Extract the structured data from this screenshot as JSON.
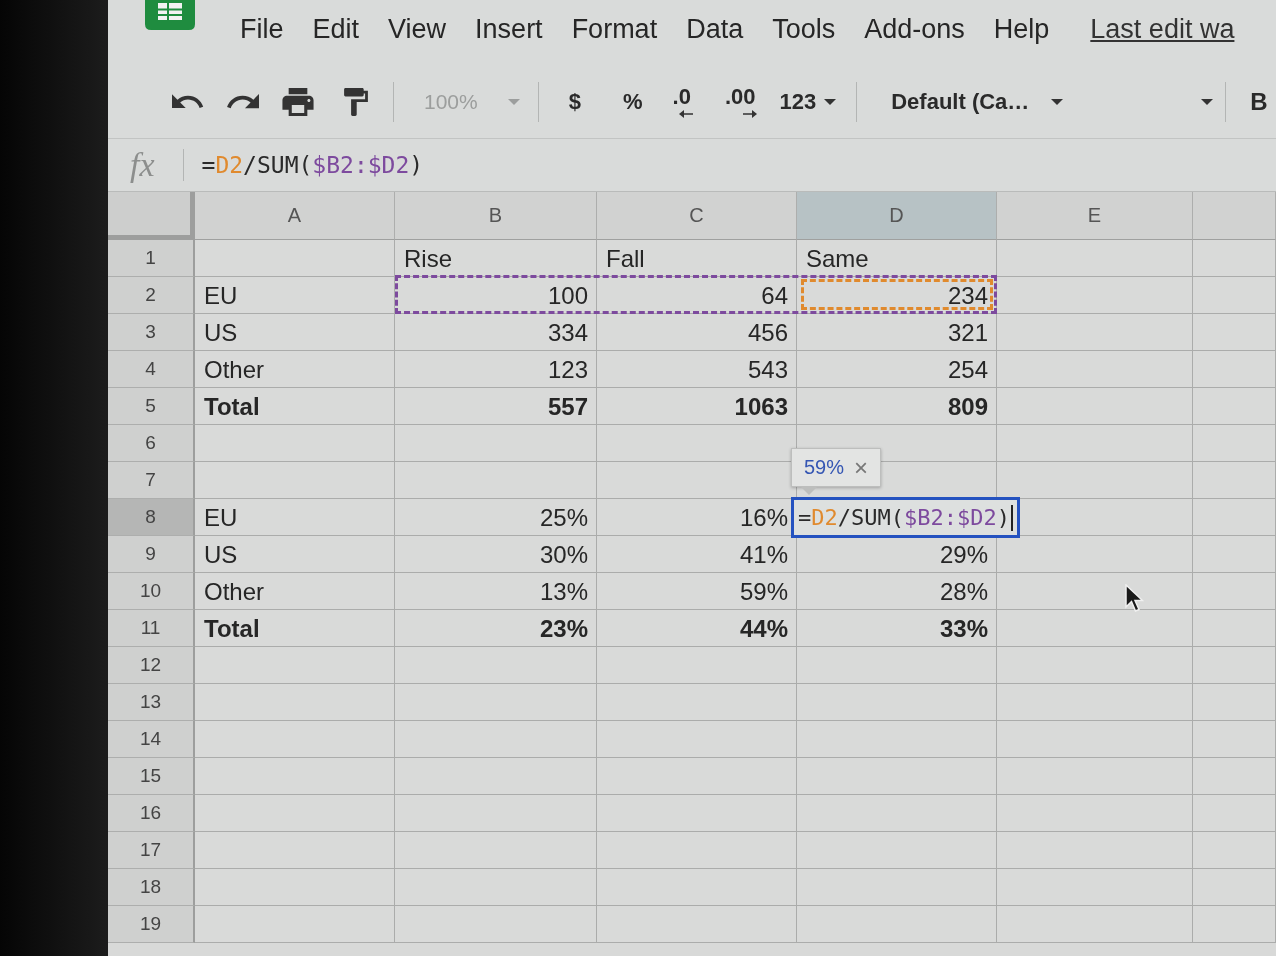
{
  "menu": [
    "File",
    "Edit",
    "View",
    "Insert",
    "Format",
    "Data",
    "Tools",
    "Add-ons",
    "Help"
  ],
  "last_edit": "Last edit wa",
  "toolbar": {
    "zoom": {
      "value": "100%",
      "disabled": true
    },
    "format_buttons": [
      {
        "label": "$",
        "kind": "plain"
      },
      {
        "label": "%",
        "kind": "plain"
      },
      {
        "label": ".0",
        "kind": "decrease"
      },
      {
        "label": ".00",
        "kind": "increase"
      }
    ],
    "number_format": "123",
    "font": "Default (Ca…",
    "bold": "B"
  },
  "formula_bar": {
    "label": "fx",
    "formula": [
      {
        "text": "="
      },
      {
        "text": "D2",
        "color": "#e08a2e"
      },
      {
        "text": "/SUM("
      },
      {
        "text": "$B2:$D2",
        "color": "#7d4a9e"
      },
      {
        "text": ")"
      }
    ]
  },
  "sheet": {
    "columns": [
      {
        "label": "A",
        "selected": false
      },
      {
        "label": "B",
        "selected": false
      },
      {
        "label": "C",
        "selected": false
      },
      {
        "label": "D",
        "selected": true
      },
      {
        "label": "E",
        "selected": false
      }
    ],
    "rows": [
      {
        "number": "1",
        "selected": false,
        "bold": false,
        "cells": [
          null,
          {
            "kind": "text",
            "text": "Rise"
          },
          {
            "kind": "text",
            "text": "Fall"
          },
          {
            "kind": "text",
            "text": "Same"
          }
        ]
      },
      {
        "number": "2",
        "selected": false,
        "bold": false,
        "cells": [
          {
            "kind": "text",
            "text": "EU"
          },
          {
            "kind": "number",
            "text": "100",
            "highlights": [
              {
                "color": "#7d4a9e"
              }
            ]
          },
          {
            "kind": "number",
            "text": "64",
            "highlights": [
              {
                "color": "#7d4a9e"
              }
            ]
          },
          {
            "kind": "number",
            "text": "234",
            "highlights": [
              {
                "color": "#7d4a9e"
              },
              {
                "color": "#e08a2e"
              }
            ]
          }
        ]
      },
      {
        "number": "3",
        "selected": false,
        "bold": false,
        "cells": [
          {
            "kind": "text",
            "text": "US"
          },
          {
            "kind": "number",
            "text": "334"
          },
          {
            "kind": "number",
            "text": "456"
          },
          {
            "kind": "number",
            "text": "321"
          }
        ]
      },
      {
        "number": "4",
        "selected": false,
        "bold": false,
        "cells": [
          {
            "kind": "text",
            "text": "Other"
          },
          {
            "kind": "number",
            "text": "123"
          },
          {
            "kind": "number",
            "text": "543"
          },
          {
            "kind": "number",
            "text": "254"
          }
        ]
      },
      {
        "number": "5",
        "selected": false,
        "bold": true,
        "cells": [
          {
            "kind": "text",
            "text": "Total"
          },
          {
            "kind": "number",
            "text": "557"
          },
          {
            "kind": "number",
            "text": "1063"
          },
          {
            "kind": "number",
            "text": "809"
          }
        ]
      },
      {
        "number": "6",
        "selected": false
      },
      {
        "number": "7",
        "selected": false
      },
      {
        "number": "8",
        "selected": true,
        "bold": false,
        "cells": [
          {
            "kind": "text",
            "text": "EU"
          },
          {
            "kind": "number",
            "text": "25%"
          },
          {
            "kind": "number",
            "text": "16%"
          },
          {
            "kind": "editor",
            "formula": [
              {
                "text": "="
              },
              {
                "text": "D2",
                "color": "#e08a2e"
              },
              {
                "text": "/SUM("
              },
              {
                "text": "$B2:$D2",
                "color": "#7d4a9e"
              },
              {
                "text": ")"
              }
            ],
            "tooltip": {
              "value": "59%",
              "close": "×"
            }
          }
        ]
      },
      {
        "number": "9",
        "selected": false,
        "bold": false,
        "cells": [
          {
            "kind": "text",
            "text": "US"
          },
          {
            "kind": "number",
            "text": "30%"
          },
          {
            "kind": "number",
            "text": "41%"
          },
          {
            "kind": "number",
            "text": "29%"
          }
        ]
      },
      {
        "number": "10",
        "selected": false,
        "bold": false,
        "cells": [
          {
            "kind": "text",
            "text": "Other"
          },
          {
            "kind": "number",
            "text": "13%"
          },
          {
            "kind": "number",
            "text": "59%"
          },
          {
            "kind": "number",
            "text": "28%"
          }
        ]
      },
      {
        "number": "11",
        "selected": false,
        "bold": true,
        "cells": [
          {
            "kind": "text",
            "text": "Total"
          },
          {
            "kind": "number",
            "text": "23%"
          },
          {
            "kind": "number",
            "text": "44%"
          },
          {
            "kind": "number",
            "text": "33%"
          }
        ]
      },
      {
        "number": "12",
        "selected": false
      },
      {
        "number": "13",
        "selected": false
      },
      {
        "number": "14",
        "selected": false
      },
      {
        "number": "15",
        "selected": false
      },
      {
        "number": "16",
        "selected": false
      },
      {
        "number": "17",
        "selected": false
      },
      {
        "number": "18",
        "selected": false
      },
      {
        "number": "19",
        "selected": false
      }
    ]
  }
}
